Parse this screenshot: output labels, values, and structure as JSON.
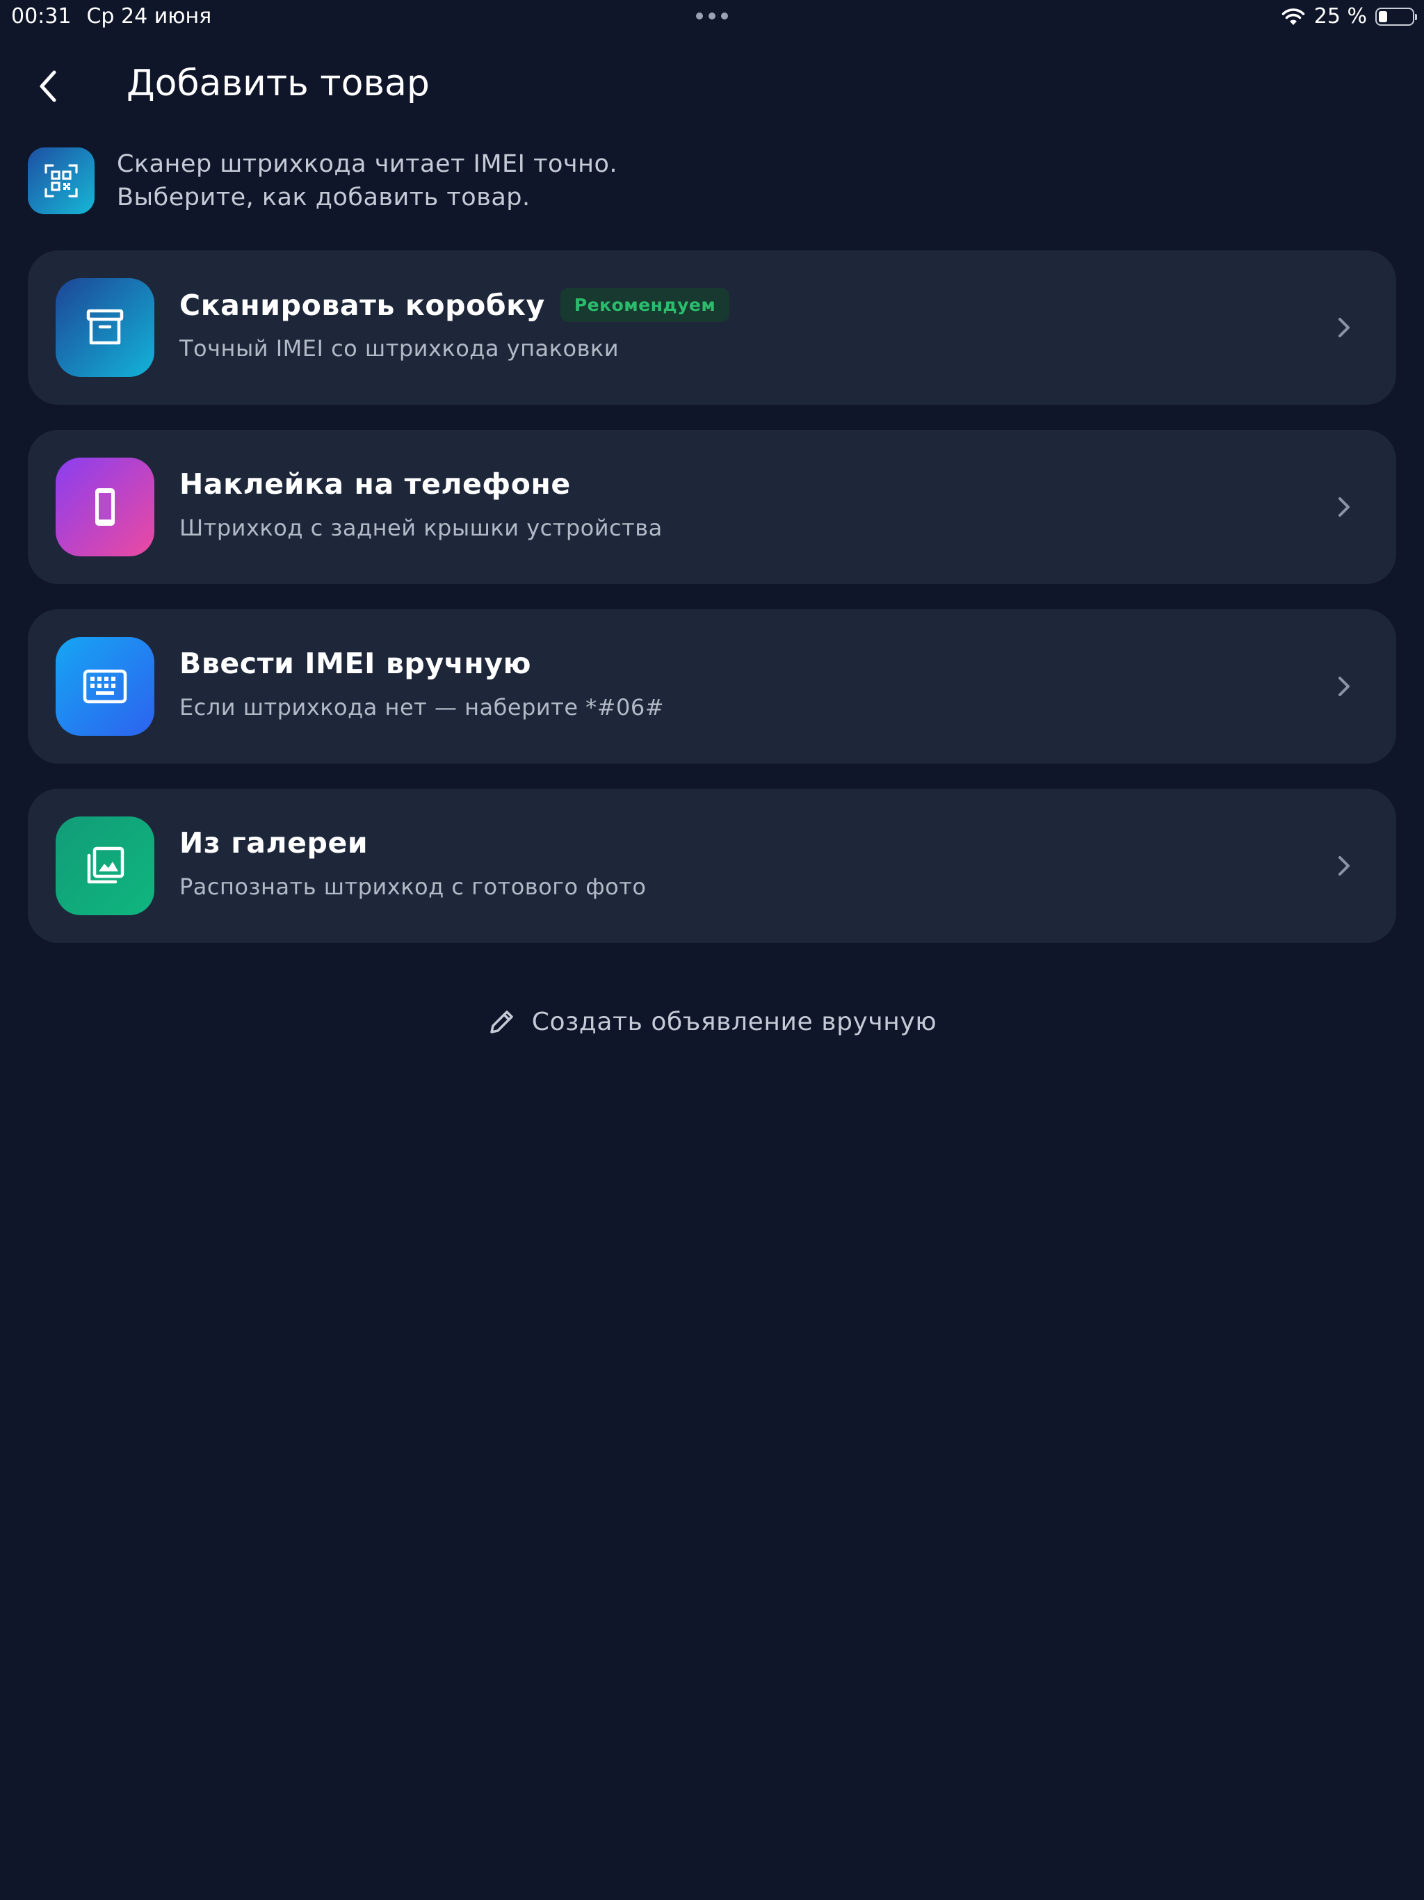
{
  "status_bar": {
    "time": "00:31",
    "date": "Ср 24 июня",
    "battery_text": "25 %",
    "battery_level": 0.25
  },
  "header": {
    "title": "Добавить товар",
    "back_icon": "chevron-left-icon"
  },
  "intro": {
    "icon": "qr-scan-icon",
    "line1": "Сканер штрихкода читает IMEI точно.",
    "line2": "Выберите, как добавить товар."
  },
  "options": [
    {
      "icon": "archive-box-icon",
      "title": "Сканировать коробку",
      "badge": "Рекомендуем",
      "subtitle": "Точный IMEI со штрихкода упаковки"
    },
    {
      "icon": "phone-icon",
      "title": "Наклейка на телефоне",
      "subtitle": "Штрихкод с задней крышки устройства"
    },
    {
      "icon": "keyboard-icon",
      "title": "Ввести IMEI вручную",
      "subtitle": "Если штрихкода нет — наберите *#06#"
    },
    {
      "icon": "gallery-icon",
      "title": "Из галереи",
      "subtitle": "Распознать штрихкод с готового фото"
    }
  ],
  "manual_link": {
    "icon": "pencil-icon",
    "label": "Создать объявление вручную"
  },
  "colors": {
    "background": "#0f1629",
    "card": "#1e273a",
    "badge_bg": "#17392f",
    "badge_text": "#2bbd6e",
    "muted_text": "#b2bac7"
  }
}
